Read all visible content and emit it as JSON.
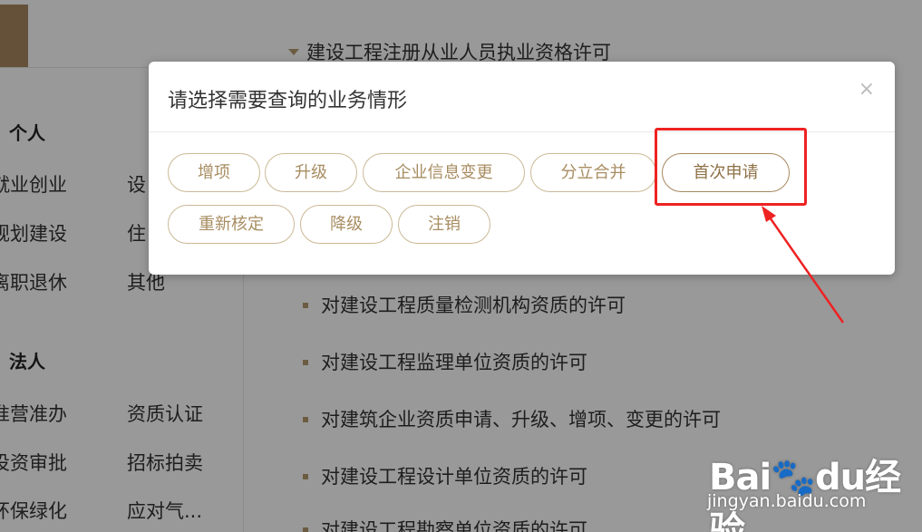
{
  "background": {
    "top_item": "建设工程注册从业人员执业资格许可",
    "sections": [
      {
        "title": "个人",
        "rows": [
          [
            "就业创业",
            "设"
          ],
          [
            "规划建设",
            "住"
          ],
          [
            "离职退休",
            "其他"
          ]
        ]
      },
      {
        "title": "法人",
        "rows": [
          [
            "准营准办",
            "资质认证"
          ],
          [
            "投资审批",
            "招标拍卖"
          ],
          [
            "环保绿化",
            "应对气..."
          ]
        ]
      }
    ],
    "list": [
      "对建设工程质量检测机构资质的许可",
      "对建设工程监理单位资质的许可",
      "对建筑企业资质申请、升级、增项、变更的许可",
      "对建设工程设计单位资质的许可",
      "对建设工程勘察单位资质的许可"
    ]
  },
  "modal": {
    "title": "请选择需要查询的业务情形",
    "close": "×",
    "options": [
      "增项",
      "升级",
      "企业信息变更",
      "分立合并",
      "首次申请",
      "重新核定",
      "降级",
      "注销"
    ]
  },
  "watermark": {
    "logo_a": "Bai",
    "logo_b": "du",
    "logo_c": "经验",
    "url": "jingyan.baidu.com"
  },
  "colors": {
    "accent": "#a8885f",
    "option_text": "#a88d62",
    "annotation": "#ee2222"
  }
}
